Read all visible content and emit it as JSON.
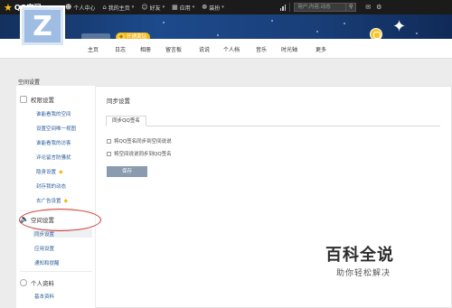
{
  "topbar": {
    "logo_text": "QQ空间",
    "nav": [
      {
        "label": "个人中心",
        "icon": "user-icon"
      },
      {
        "label": "我的主页",
        "icon": "home-icon",
        "has_caret": true
      },
      {
        "label": "好友",
        "icon": "friends-icon",
        "has_caret": true
      },
      {
        "label": "应用",
        "icon": "apps-icon",
        "has_caret": true
      },
      {
        "label": "装扮",
        "icon": "decorate-icon",
        "has_caret": true
      }
    ],
    "search_placeholder": "用户,内容,动态"
  },
  "banner": {
    "badge_text": "开通黄钻"
  },
  "nav_tabs": [
    "主页",
    "日志",
    "相册",
    "留言板",
    "说说",
    "个人档",
    "音乐",
    "时光轴",
    "更多"
  ],
  "page_title": "空间设置",
  "sidebar": {
    "sections": [
      {
        "title": "权限设置",
        "icon": "lock-icon",
        "items": [
          {
            "label": "谁能看我的空间"
          },
          {
            "label": "设置空间唯一视图"
          },
          {
            "label": "谁能看我的访客"
          },
          {
            "label": "评论留言防骚扰"
          },
          {
            "label": "隐身设置",
            "gem": true
          },
          {
            "label": "封存我的动态"
          },
          {
            "label": "去广告设置",
            "gem": true
          }
        ]
      },
      {
        "title": "空间设置",
        "icon": "speaker-icon",
        "items": [
          {
            "label": "同步设置",
            "active": true
          },
          {
            "label": "应用设置"
          },
          {
            "label": "通知和提醒"
          }
        ]
      },
      {
        "title": "个人资料",
        "icon": "person-icon",
        "items": [
          {
            "label": "基本资料"
          }
        ]
      }
    ]
  },
  "content": {
    "title": "同步设置",
    "tab_label": "同步QQ签名",
    "options": [
      {
        "label": "将QQ签名同步到空间说说"
      },
      {
        "label": "将空间说说同步到QQ签名"
      }
    ],
    "save_label": "保存"
  },
  "watermark": {
    "title": "百科全说",
    "subtitle": "助你轻松解决"
  }
}
